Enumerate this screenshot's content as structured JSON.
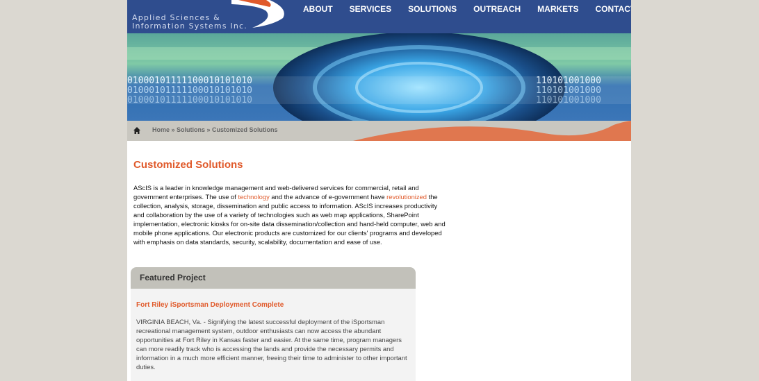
{
  "header": {
    "tagline_line1": "Applied Sciences &",
    "tagline_line2": "Information Systems Inc.",
    "nav": [
      "ABOUT",
      "SERVICES",
      "SOLUTIONS",
      "OUTREACH",
      "MARKETS",
      "CONTACT"
    ]
  },
  "banner": {
    "binary_row1": "01000101111100010101010",
    "binary_row2": "01000101111100010101010",
    "binary_row3": "01000101111100010101010",
    "binary_right1": "110101001000",
    "binary_right2": "110101001000",
    "binary_right3": "110101001000"
  },
  "breadcrumb": {
    "home": "Home",
    "sep": " » ",
    "solutions": "Solutions",
    "current": "Customized Solutions"
  },
  "main": {
    "title": "Customized Solutions",
    "intro_1": "AScIS is a leader in knowledge management and web-delivered services for commercial, retail and government enterprises. The use of ",
    "link_technology": "technology",
    "intro_2": " and the advance of e-government have ",
    "link_revolutionized": "revolutionized",
    "intro_3": " the collection, analysis, storage, dissemination and public access to information. AScIS increases productivity and collaboration by the use of a variety of technologies such as web map applications, SharePoint implementation, electronic kiosks for on-site data dissemination/collection and hand-held computer, web and mobile phone applications. Our electronic products are customized for our clients' programs and developed with emphasis on data standards, security, scalability, documentation and ease of use."
  },
  "featured": {
    "header": "Featured Project",
    "title": "Fort Riley iSportsman Deployment Complete",
    "body": "VIRGINIA BEACH, Va. - Signifying the latest successful deployment of the iSportsman recreational management system, outdoor enthusiasts can now access the abundant opportunities at Fort Riley in Kansas faster and easier. At the same time, program managers can more readily track who is accessing the lands and provide the necessary permits and information in a much more efficient manner, freeing their time to administer to other important duties."
  },
  "colors": {
    "header_bg": "#2f4d8e",
    "accent": "#e05a2b",
    "page_bg": "#dbd8d1"
  }
}
